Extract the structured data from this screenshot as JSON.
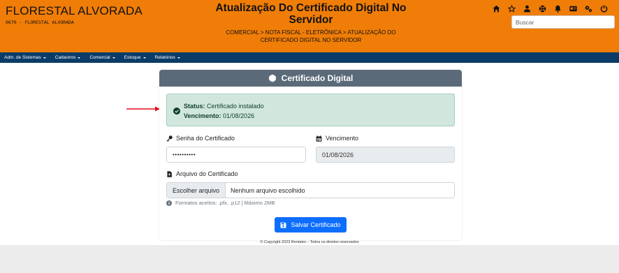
{
  "header": {
    "company_name": "FLORESTAL ALVORADA",
    "company_code": "0670 - FLORESTAL ALVORADA",
    "page_title": "Atualização Do Certificado Digital No Servidor",
    "breadcrumb": "COMERCIAL > NOTA FISCAL - ELETRÔNICA > ATUALIZAÇÃO DO CERTIFICADO DIGITAL NO SERVIDOR",
    "icons": [
      "home-icon",
      "star-icon",
      "user-icon",
      "support-icon",
      "bell-icon",
      "id-card-icon",
      "settings-icon",
      "power-icon"
    ],
    "search_placeholder": "Buscar",
    "background_color": "#f07d07"
  },
  "nav": {
    "items": [
      {
        "label": "Adm. de Sistemas"
      },
      {
        "label": "Cadastros"
      },
      {
        "label": "Comercial"
      },
      {
        "label": "Estoque"
      },
      {
        "label": "Relatórios"
      }
    ],
    "background_color": "#0b3c68"
  },
  "card": {
    "title": "Certificado Digital",
    "status": {
      "status_label": "Status:",
      "status_value": "Certificado instalado",
      "expiry_label": "Vencimento:",
      "expiry_value": "01/08/2026"
    },
    "password": {
      "label": "Senha do Certificado",
      "value": "••••••••••"
    },
    "expiry": {
      "label": "Vencimento",
      "value": "01/08/2026"
    },
    "file": {
      "label": "Arquivo do Certificado",
      "button_label": "Escolher arquivo",
      "no_file_text": "Nenhum arquivo escolhido",
      "help_text": "Formatos aceitos: .pfx, .p12 | Máximo 2MB"
    },
    "save_label": "Salvar Certificado"
  },
  "footer": {
    "copyright": "© Copyright 2023 Rentatec - Todos os direitos reservados"
  }
}
